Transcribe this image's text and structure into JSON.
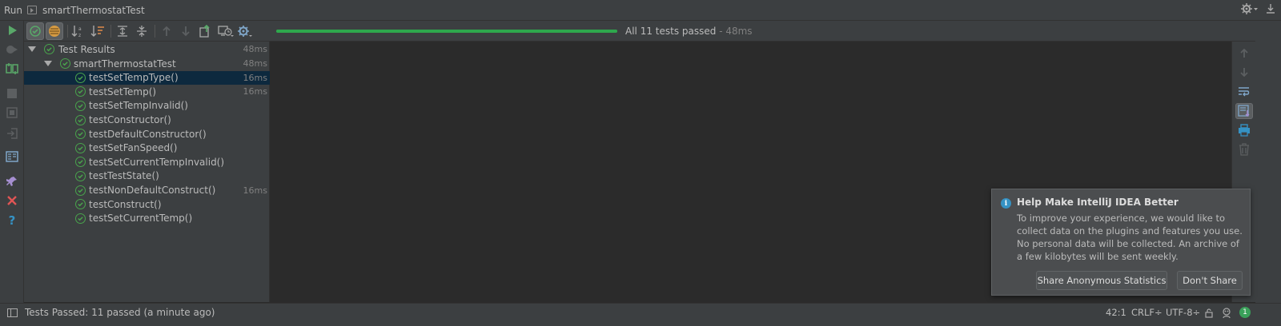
{
  "window": {
    "tool_label": "Run",
    "tab_name": "smartThermostatTest",
    "right_icons": [
      "gear-icon",
      "minimize-icon"
    ]
  },
  "left_toolbar": {
    "icons": [
      "rerun-icon",
      "rerun-failed-icon",
      "toggle-auto-test-icon",
      "stop-icon",
      "dump-threads-icon",
      "exit-icon",
      "layout-icon",
      "pin-icon",
      "close-icon",
      "help-icon"
    ]
  },
  "top_toolbar": {
    "icons": [
      "show-passed-icon",
      "show-ignored-icon",
      "sort-alphabetically-icon",
      "sort-by-duration-icon",
      "expand-all-icon",
      "collapse-all-icon",
      "previous-failed-icon",
      "next-failed-icon",
      "export-results-icon",
      "import-tests-icon",
      "settings-icon"
    ],
    "progress": 1.0,
    "summary_main": "All 11 tests passed",
    "summary_time": " - 48ms"
  },
  "tree": {
    "root": {
      "label": "Test Results",
      "duration": "48ms"
    },
    "suite": {
      "label": "smartThermostatTest",
      "duration": "48ms"
    },
    "tests": [
      {
        "label": "testSetTempType()",
        "duration": "16ms"
      },
      {
        "label": "testSetTemp()",
        "duration": "16ms"
      },
      {
        "label": "testSetTempInvalid()",
        "duration": ""
      },
      {
        "label": "testConstructor()",
        "duration": ""
      },
      {
        "label": "testDefaultConstructor()",
        "duration": ""
      },
      {
        "label": "testSetFanSpeed()",
        "duration": ""
      },
      {
        "label": "testSetCurrentTempInvalid()",
        "duration": ""
      },
      {
        "label": "testTestState()",
        "duration": ""
      },
      {
        "label": "testNonDefaultConstruct()",
        "duration": "16ms"
      },
      {
        "label": "testConstruct()",
        "duration": ""
      },
      {
        "label": "testSetCurrentTemp()",
        "duration": ""
      }
    ]
  },
  "right_toolbar": {
    "icons": [
      "up-stack-icon",
      "down-stack-icon",
      "soft-wrap-icon",
      "scroll-to-end-icon",
      "print-icon",
      "clear-all-icon"
    ]
  },
  "notification": {
    "title": "Help Make IntelliJ IDEA Better",
    "body": "To improve your experience, we would like to collect data on the plugins and features you use. No personal data will be collected. An archive of a few kilobytes will be sent weekly.",
    "share_button": "Share Anonymous Statistics",
    "decline_button": "Don't Share"
  },
  "statusbar": {
    "text": "Tests Passed: 11 passed (a minute ago)",
    "position": "42:1",
    "line_separator": "CRLF÷",
    "encoding": "UTF-8÷",
    "notifications_count": "1"
  },
  "colors": {
    "background": "#2b2b2b",
    "panel": "#3c3f41",
    "pass_green": "#49a34c",
    "selection": "#0d293e",
    "progress_green": "#2ea84d",
    "info_blue": "#3592c4"
  }
}
